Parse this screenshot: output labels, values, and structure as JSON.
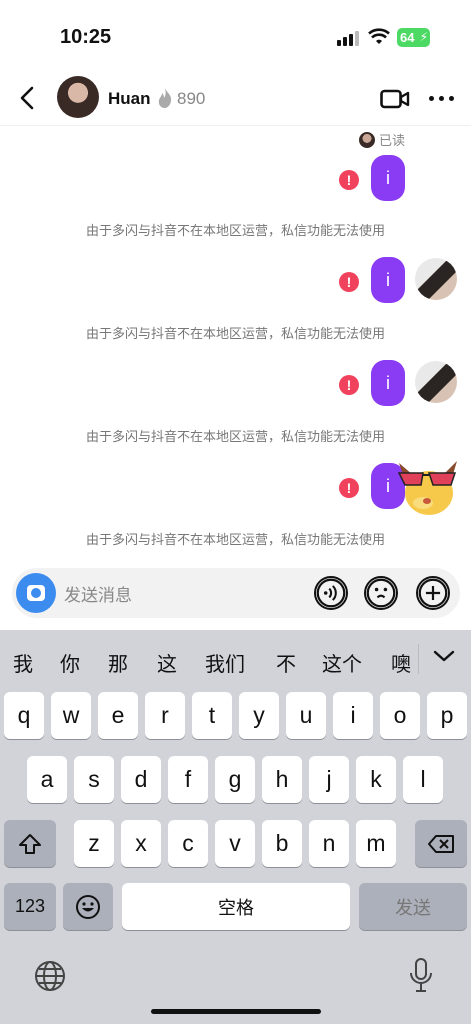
{
  "status_bar": {
    "time": "10:25",
    "battery": "64"
  },
  "header": {
    "name": "Huan",
    "intimacy_count": "890"
  },
  "read_receipt": "已读",
  "messages": [
    {
      "text": "i",
      "note": "由于多闪与抖音不在本地区运营，私信功能无法使用"
    },
    {
      "text": "i",
      "note": "由于多闪与抖音不在本地区运营，私信功能无法使用"
    },
    {
      "text": "i",
      "note": "由于多闪与抖音不在本地区运营，私信功能无法使用"
    },
    {
      "text": "i",
      "note": "由于多闪与抖音不在本地区运营，私信功能无法使用"
    }
  ],
  "input": {
    "placeholder": "发送消息"
  },
  "suggestions": [
    "我",
    "你",
    "那",
    "这",
    "我们",
    "不",
    "这个",
    "噢"
  ],
  "keyboard": {
    "row1": [
      "q",
      "w",
      "e",
      "r",
      "t",
      "y",
      "u",
      "i",
      "o",
      "p"
    ],
    "row2": [
      "a",
      "s",
      "d",
      "f",
      "g",
      "h",
      "j",
      "k",
      "l"
    ],
    "row3": [
      "z",
      "x",
      "c",
      "v",
      "b",
      "n",
      "m"
    ],
    "numbers_key": "123",
    "space_key": "空格",
    "send_key": "发送"
  },
  "colors": {
    "bubble": "#8a3cf4",
    "error": "#f0425c",
    "camera": "#3c8cf0",
    "battery": "#4cd964"
  },
  "icons": [
    "back-icon",
    "flame-icon",
    "video-call-icon",
    "more-icon",
    "error-icon",
    "camera-icon",
    "voice-icon",
    "emoji-icon",
    "plus-icon",
    "chevron-down-icon",
    "shift-icon",
    "backspace-icon",
    "emoji-key-icon",
    "globe-icon",
    "microphone-icon"
  ]
}
